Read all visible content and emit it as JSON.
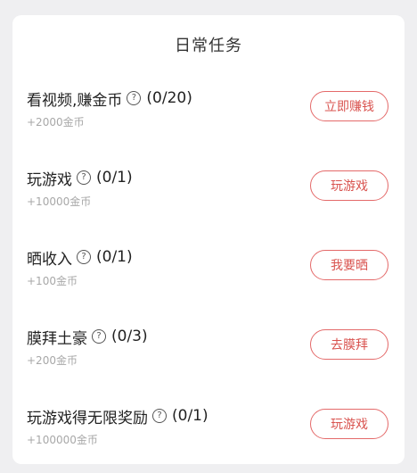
{
  "card": {
    "title": "日常任务"
  },
  "tasks": [
    {
      "name": "看视频,赚金币",
      "progress": "(0/20)",
      "reward": "+2000金币",
      "button": "立即赚钱"
    },
    {
      "name": "玩游戏",
      "progress": "(0/1)",
      "reward": "+10000金币",
      "button": "玩游戏"
    },
    {
      "name": "晒收入",
      "progress": "(0/1)",
      "reward": "+100金币",
      "button": "我要晒"
    },
    {
      "name": "膜拜土豪",
      "progress": "(0/3)",
      "reward": "+200金币",
      "button": "去膜拜"
    },
    {
      "name": "玩游戏得无限奖励",
      "progress": "(0/1)",
      "reward": "+100000金币",
      "button": "玩游戏"
    }
  ],
  "icons": {
    "help": "question-circle-icon"
  },
  "colors": {
    "accent": "#e46a6a",
    "reward_text": "#a8a8a8"
  }
}
